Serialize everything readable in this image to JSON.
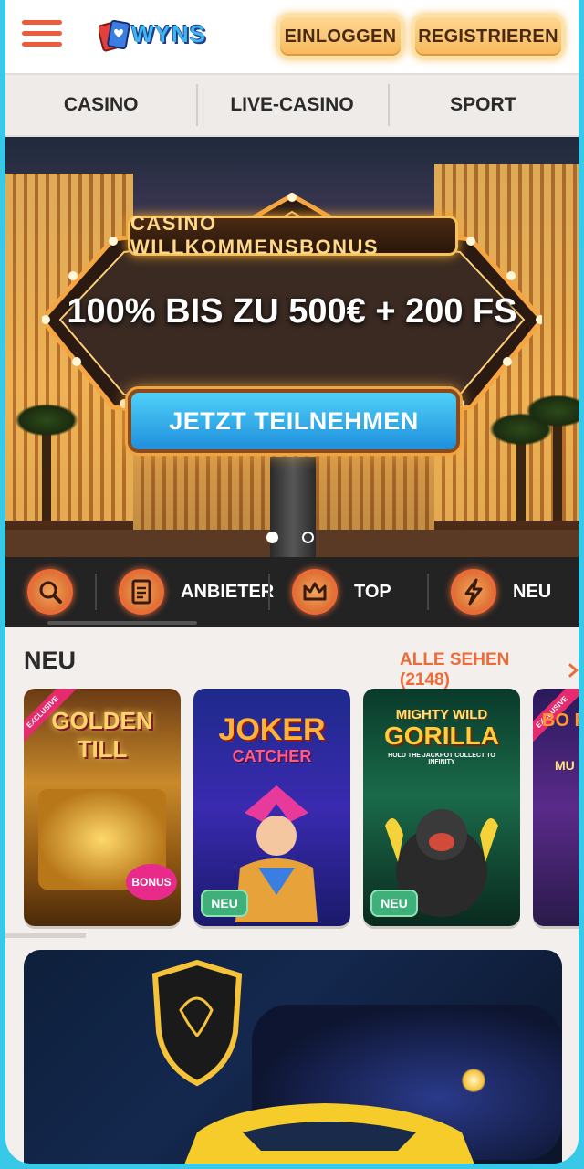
{
  "header": {
    "logo_text": "WYNS",
    "login_label": "EINLOGGEN",
    "register_label": "REGISTRIEREN"
  },
  "topnav": {
    "tabs": [
      {
        "label": "CASINO"
      },
      {
        "label": "LIVE-CASINO"
      },
      {
        "label": "SPORT"
      }
    ]
  },
  "hero": {
    "badge": "CASINO WILLKOMMENSBONUS",
    "headline": "100% BIS ZU 500€ + 200 FS",
    "cta_label": "JETZT TEILNEHMEN",
    "slides_total": 2,
    "active_slide": 1
  },
  "categories": [
    {
      "icon": "search-icon",
      "label": ""
    },
    {
      "icon": "document-icon",
      "label": "ANBIETER"
    },
    {
      "icon": "crown-icon",
      "label": "TOP"
    },
    {
      "icon": "lightning-icon",
      "label": "NEU"
    }
  ],
  "section_new": {
    "title": "NEU",
    "see_all": "ALLE SEHEN (2148)",
    "games": [
      {
        "title": "GOLDEN TILL",
        "badge": "",
        "exclusive": "EXCLUSIVE",
        "extra": "BONUS"
      },
      {
        "title": "JOKER",
        "subtitle": "CATCHER",
        "badge": "NEU"
      },
      {
        "title": "GORILLA",
        "subtitle": "MIGHTY WILD",
        "tagline": "HOLD THE JACKPOT COLLECT TO INFINITY",
        "badge": "NEU"
      },
      {
        "title": "BO FR",
        "subtitle": "MU",
        "exclusive": "EXCLUSIVE"
      }
    ]
  },
  "colors": {
    "accent": "#ee6a36",
    "frame": "#38c9e9",
    "cta": "#1f8fdc",
    "badge_new": "#3fb07a"
  }
}
